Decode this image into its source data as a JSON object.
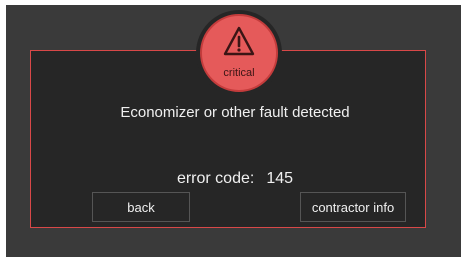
{
  "dialog": {
    "badge_label": "critical",
    "badge_icon": "warning-triangle-icon",
    "message": "Economizer or other fault detected",
    "error_label": "error code:",
    "error_code": "145"
  },
  "buttons": {
    "back": "back",
    "contractor": "contractor info"
  },
  "colors": {
    "background": "#3a3a3a",
    "panel": "#262626",
    "accent": "#e55a5a",
    "text": "#f0f0f0"
  }
}
